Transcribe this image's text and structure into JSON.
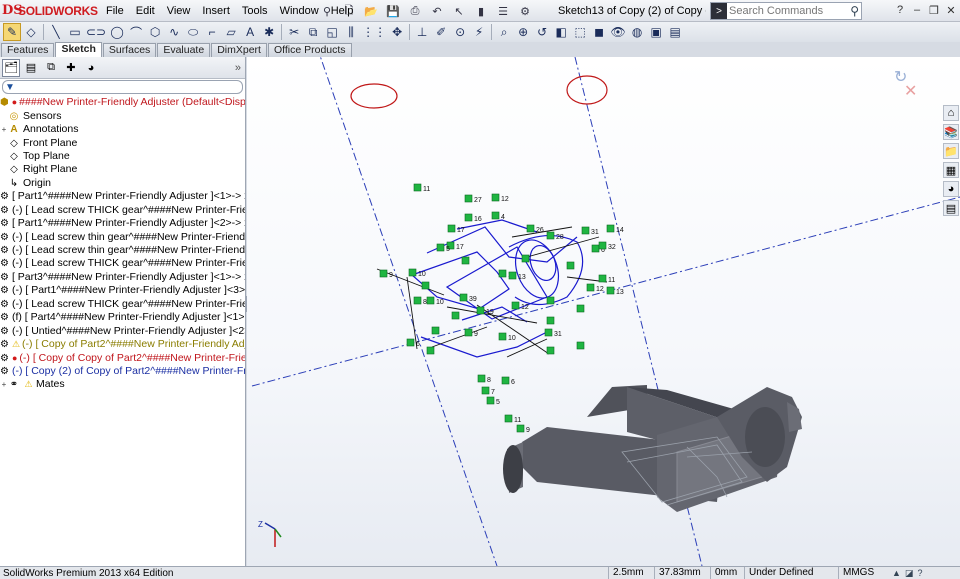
{
  "app": {
    "logo_mark": "DS",
    "logo_name": "SOLIDWORKS",
    "document_title": "Sketch13 of Copy (2) of Copy of Part..."
  },
  "menu": [
    "File",
    "Edit",
    "View",
    "Insert",
    "Tools",
    "Window",
    "Help"
  ],
  "search": {
    "placeholder": "Search Commands"
  },
  "tabs": [
    {
      "label": "Features"
    },
    {
      "label": "Sketch"
    },
    {
      "label": "Surfaces"
    },
    {
      "label": "Evaluate"
    },
    {
      "label": "DimXpert"
    },
    {
      "label": "Office Products"
    }
  ],
  "active_tab": "Sketch",
  "tree": {
    "root": "####New Printer-Friendly Adjuster  (Default<Displa",
    "items": [
      {
        "label": "Sensors",
        "icon": "sensor-icon"
      },
      {
        "label": "Annotations",
        "icon": "annotations-icon"
      },
      {
        "label": "Front Plane",
        "icon": "plane-icon"
      },
      {
        "label": "Top Plane",
        "icon": "plane-icon"
      },
      {
        "label": "Right Plane",
        "icon": "plane-icon"
      },
      {
        "label": "Origin",
        "icon": "origin-icon"
      },
      {
        "label": "[ Part1^####New Printer-Friendly Adjuster ]<1>-> x (",
        "icon": "part-icon"
      },
      {
        "label": "(-) [ Lead screw THICK gear^####New Printer-Friendly",
        "icon": "part-icon"
      },
      {
        "label": "[ Part1^####New Printer-Friendly Adjuster ]<2>-> x (",
        "icon": "part-icon"
      },
      {
        "label": "(-) [ Lead screw thin gear^####New Printer-Friendly A",
        "icon": "part-icon"
      },
      {
        "label": "(-) [ Lead screw thin gear^####New Printer-Friendly A",
        "icon": "part-icon"
      },
      {
        "label": "(-) [ Lead screw THICK gear^####New Printer-Friendly",
        "icon": "part-icon"
      },
      {
        "label": "[ Part3^####New Printer-Friendly Adjuster ]<1>-> x (",
        "icon": "part-icon"
      },
      {
        "label": "(-) [ Part1^####New Printer-Friendly Adjuster ]<3>->",
        "icon": "part-icon"
      },
      {
        "label": "(-) [ Lead screw THICK gear^####New Printer-Friendly",
        "icon": "part-icon"
      },
      {
        "label": "(f) [ Part4^####New Printer-Friendly Adjuster ]<1> (D",
        "icon": "part-icon"
      },
      {
        "label": "(-) [ Untied^####New Printer-Friendly Adjuster ]<2>",
        "icon": "part-icon"
      },
      {
        "label": "(-) [ Copy of Part2^####New Printer-Friendly Adju",
        "icon": "warning-icon",
        "state": "warning"
      },
      {
        "label": "(-) [ Copy of Copy of Part2^####New Printer-Frien",
        "icon": "error-icon",
        "state": "error"
      },
      {
        "label": "(-) [ Copy (2) of Copy of Part2^####New Printer-Fr",
        "icon": "part-icon",
        "state": "editing"
      },
      {
        "label": "Mates",
        "icon": "mates-icon"
      }
    ]
  },
  "viewport": {
    "axis_labels": {
      "x": "X",
      "y": "Y",
      "z": "Z"
    },
    "sketch_numbers": [
      "11",
      "27",
      "12",
      "16",
      "4",
      "17",
      "26",
      "28",
      "31",
      "14",
      "6",
      "32",
      "17",
      "5",
      "9",
      "10",
      "1",
      "13",
      "12",
      "11",
      "13",
      "8",
      "10",
      "39",
      "12",
      "9",
      "19",
      "6",
      "31",
      "10",
      "6",
      "8",
      "7",
      "5",
      "11",
      "9"
    ]
  },
  "status": {
    "edition": "SolidWorks Premium 2013 x64 Edition",
    "x": "2.5mm",
    "y": "37.83mm",
    "z": "0mm",
    "state": "Under Defined",
    "units": "MMGS"
  },
  "colors": {
    "sketch_blue": "#1a1acf",
    "relation_green": "#1fb541",
    "construction_blue": "#2c3fb8",
    "ellipse_red": "#c01818",
    "body_gray": "#5a5c66"
  }
}
